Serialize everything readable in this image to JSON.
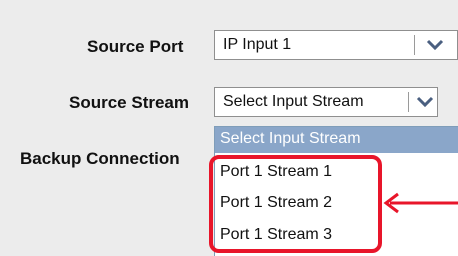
{
  "form": {
    "source_port_label": "Source Port",
    "source_port_value": "IP Input 1",
    "source_stream_label": "Source Stream",
    "source_stream_value": "Select Input Stream",
    "backup_connection_label": "Backup Connection"
  },
  "dropdown": {
    "selected_option": "Select Input Stream",
    "options": [
      "Port 1 Stream 1",
      "Port 1 Stream 2",
      "Port 1 Stream 3"
    ]
  },
  "icons": {
    "chevron": "chevron-down-icon",
    "arrow": "arrow-left-icon"
  },
  "colors": {
    "highlight": "#e8152a",
    "dropdown_header": "#8aa6c9",
    "background": "#ececec"
  }
}
